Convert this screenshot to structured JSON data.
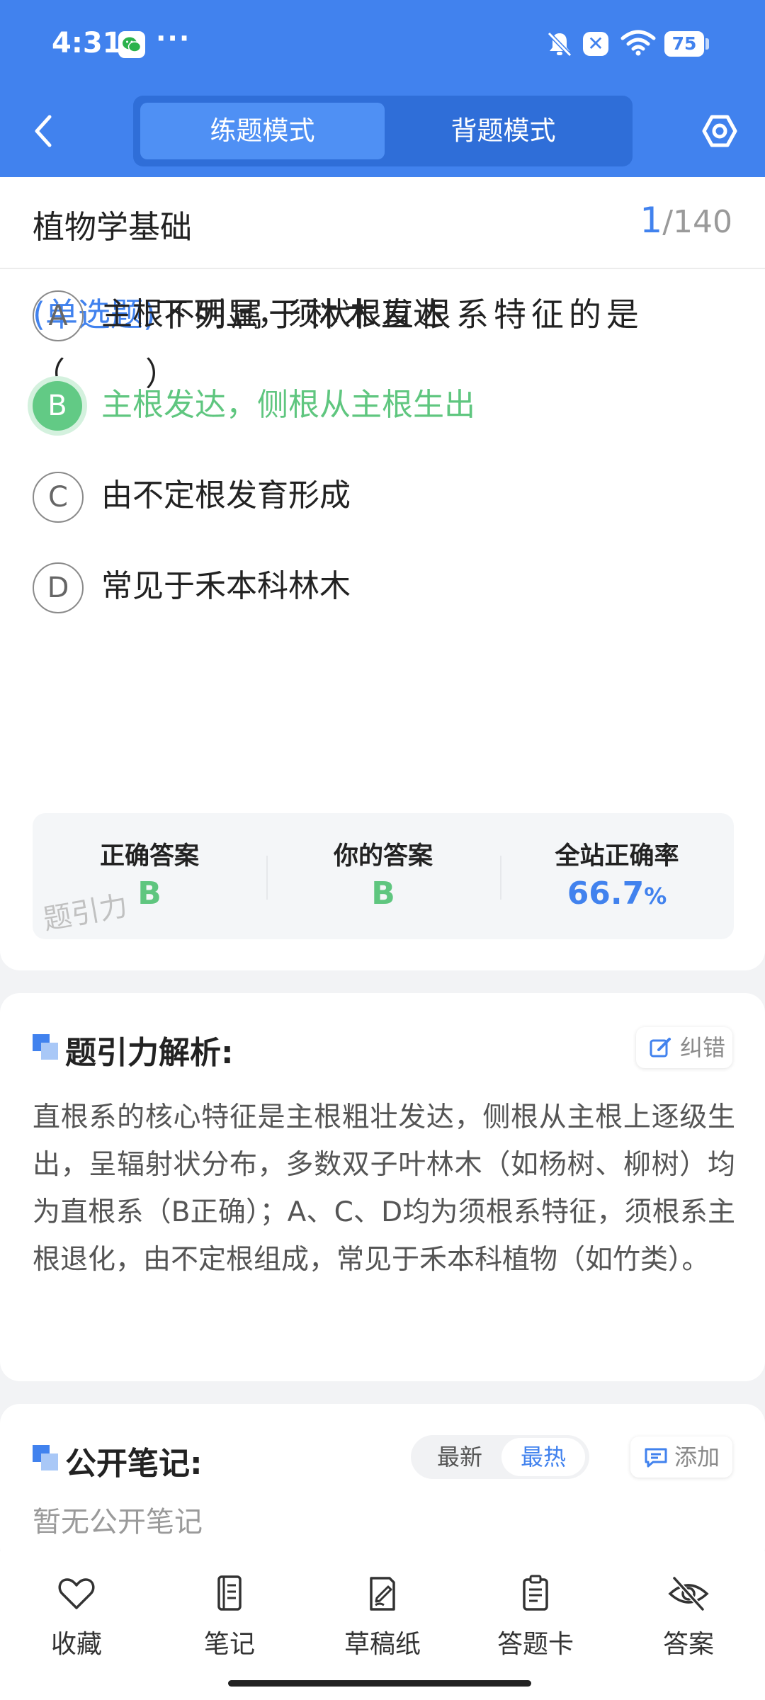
{
  "status_bar": {
    "time": "4:31",
    "more": "···",
    "battery": "75"
  },
  "header": {
    "modes": [
      "练题模式",
      "背题模式"
    ],
    "active_mode_index": 0
  },
  "question": {
    "subject": "植物学基础",
    "current": "1",
    "total": "/140",
    "type": "(单选题)",
    "text": "下列属于林木直根系特征的是（　　）",
    "options": [
      {
        "letter": "A",
        "text": "主根不明显，须状根发达",
        "selected": false
      },
      {
        "letter": "B",
        "text": "主根发达，侧根从主根生出",
        "selected": true
      },
      {
        "letter": "C",
        "text": "由不定根发育形成",
        "selected": false
      },
      {
        "letter": "D",
        "text": "常见于禾本科林木",
        "selected": false
      }
    ]
  },
  "stats": {
    "correct_label": "正确答案",
    "correct_value": "B",
    "yours_label": "你的答案",
    "yours_value": "B",
    "rate_label": "全站正确率",
    "rate_value": "66.7",
    "rate_unit": "%",
    "watermark": "题引力"
  },
  "analysis": {
    "title": "题引力解析:",
    "report_label": "纠错",
    "body": "直根系的核心特征是主根粗壮发达，侧根从主根上逐级生出，呈辐射状分布，多数双子叶林木（如杨树、柳树）均为直根系（B正确）；A、C、D均为须根系特征，须根系主根退化，由不定根组成，常见于禾本科植物（如竹类）。"
  },
  "notes": {
    "title": "公开笔记:",
    "sort_options": [
      "最新",
      "最热"
    ],
    "active_sort_index": 1,
    "add_label": "添加",
    "empty_text": "暂无公开笔记"
  },
  "bottom_nav": [
    {
      "label": "收藏",
      "icon": "heart-icon"
    },
    {
      "label": "笔记",
      "icon": "notebook-icon"
    },
    {
      "label": "草稿纸",
      "icon": "draft-icon"
    },
    {
      "label": "答题卡",
      "icon": "clipboard-icon"
    },
    {
      "label": "答案",
      "icon": "eye-off-icon"
    }
  ],
  "colors": {
    "primary": "#4182ee",
    "correct": "#5fc67f"
  }
}
